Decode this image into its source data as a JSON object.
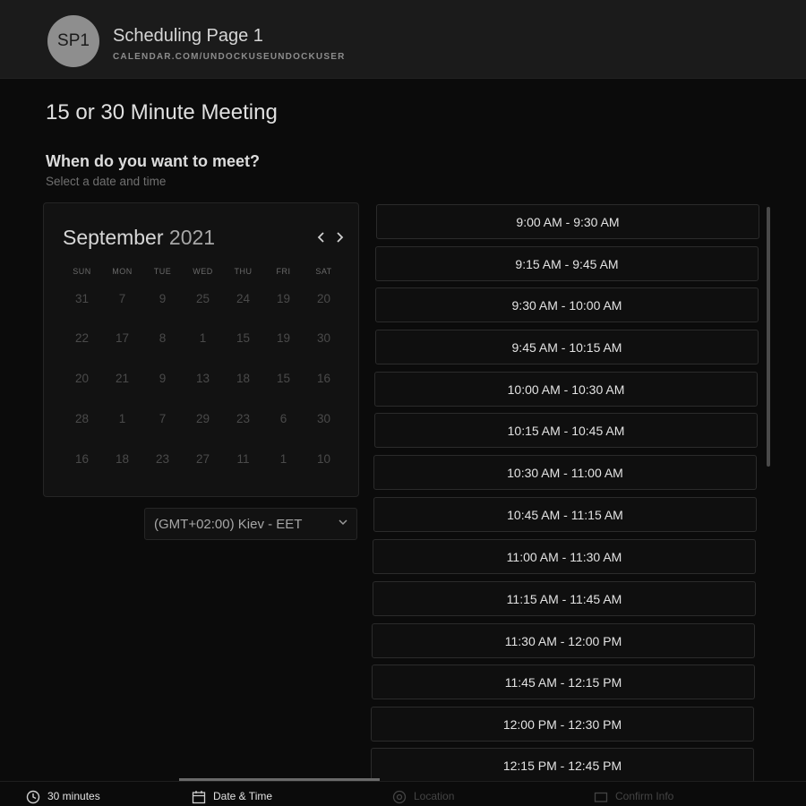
{
  "header": {
    "avatar_initials": "SP1",
    "title": "Scheduling Page 1",
    "url": "CALENDAR.COM/UNDOCKUSEUNDOCKUSER"
  },
  "meeting": {
    "title": "15 or 30 Minute Meeting",
    "question": "When do you want to meet?",
    "subtitle": "Select a date and time"
  },
  "calendar": {
    "month": "September",
    "year": "2021",
    "weekdays": [
      "SUN",
      "MON",
      "TUE",
      "WED",
      "THU",
      "FRI",
      "SAT"
    ],
    "weeks": [
      [
        "31",
        "7",
        "9",
        "25",
        "24",
        "19",
        "20"
      ],
      [
        "22",
        "17",
        "8",
        "1",
        "15",
        "19",
        "30"
      ],
      [
        "20",
        "21",
        "9",
        "13",
        "18",
        "15",
        "16"
      ],
      [
        "28",
        "1",
        "7",
        "29",
        "23",
        "6",
        "30"
      ],
      [
        "16",
        "18",
        "23",
        "27",
        "11",
        "1",
        "10"
      ]
    ],
    "prev_icon": "chevron-left-icon",
    "next_icon": "chevron-right-icon"
  },
  "timezone": {
    "label": "(GMT+02:00) Kiev - EET",
    "icon": "chevron-down-icon"
  },
  "slots": [
    "9:00 AM - 9:30 AM",
    "9:15 AM - 9:45 AM",
    "9:30 AM - 10:00 AM",
    "9:45 AM - 10:15 AM",
    "10:00 AM - 10:30 AM",
    "10:15 AM - 10:45 AM",
    "10:30 AM - 11:00 AM",
    "10:45 AM - 11:15 AM",
    "11:00 AM - 11:30 AM",
    "11:15 AM - 11:45 AM",
    "11:30 AM - 12:00 PM",
    "11:45 AM - 12:15 PM",
    "12:00 PM - 12:30 PM",
    "12:15 PM - 12:45 PM"
  ],
  "footer": {
    "steps": [
      {
        "label": "30 minutes",
        "icon": "clock-icon"
      },
      {
        "label": "Date & Time",
        "icon": "calendar-icon"
      },
      {
        "label": "Location",
        "icon": "location-icon"
      },
      {
        "label": "Confirm Info",
        "icon": "card-icon"
      }
    ],
    "active_step": 2
  },
  "colors": {
    "background": "#0b0b0b",
    "header": "#1b1b1b",
    "avatar": "#8e8e8e"
  }
}
